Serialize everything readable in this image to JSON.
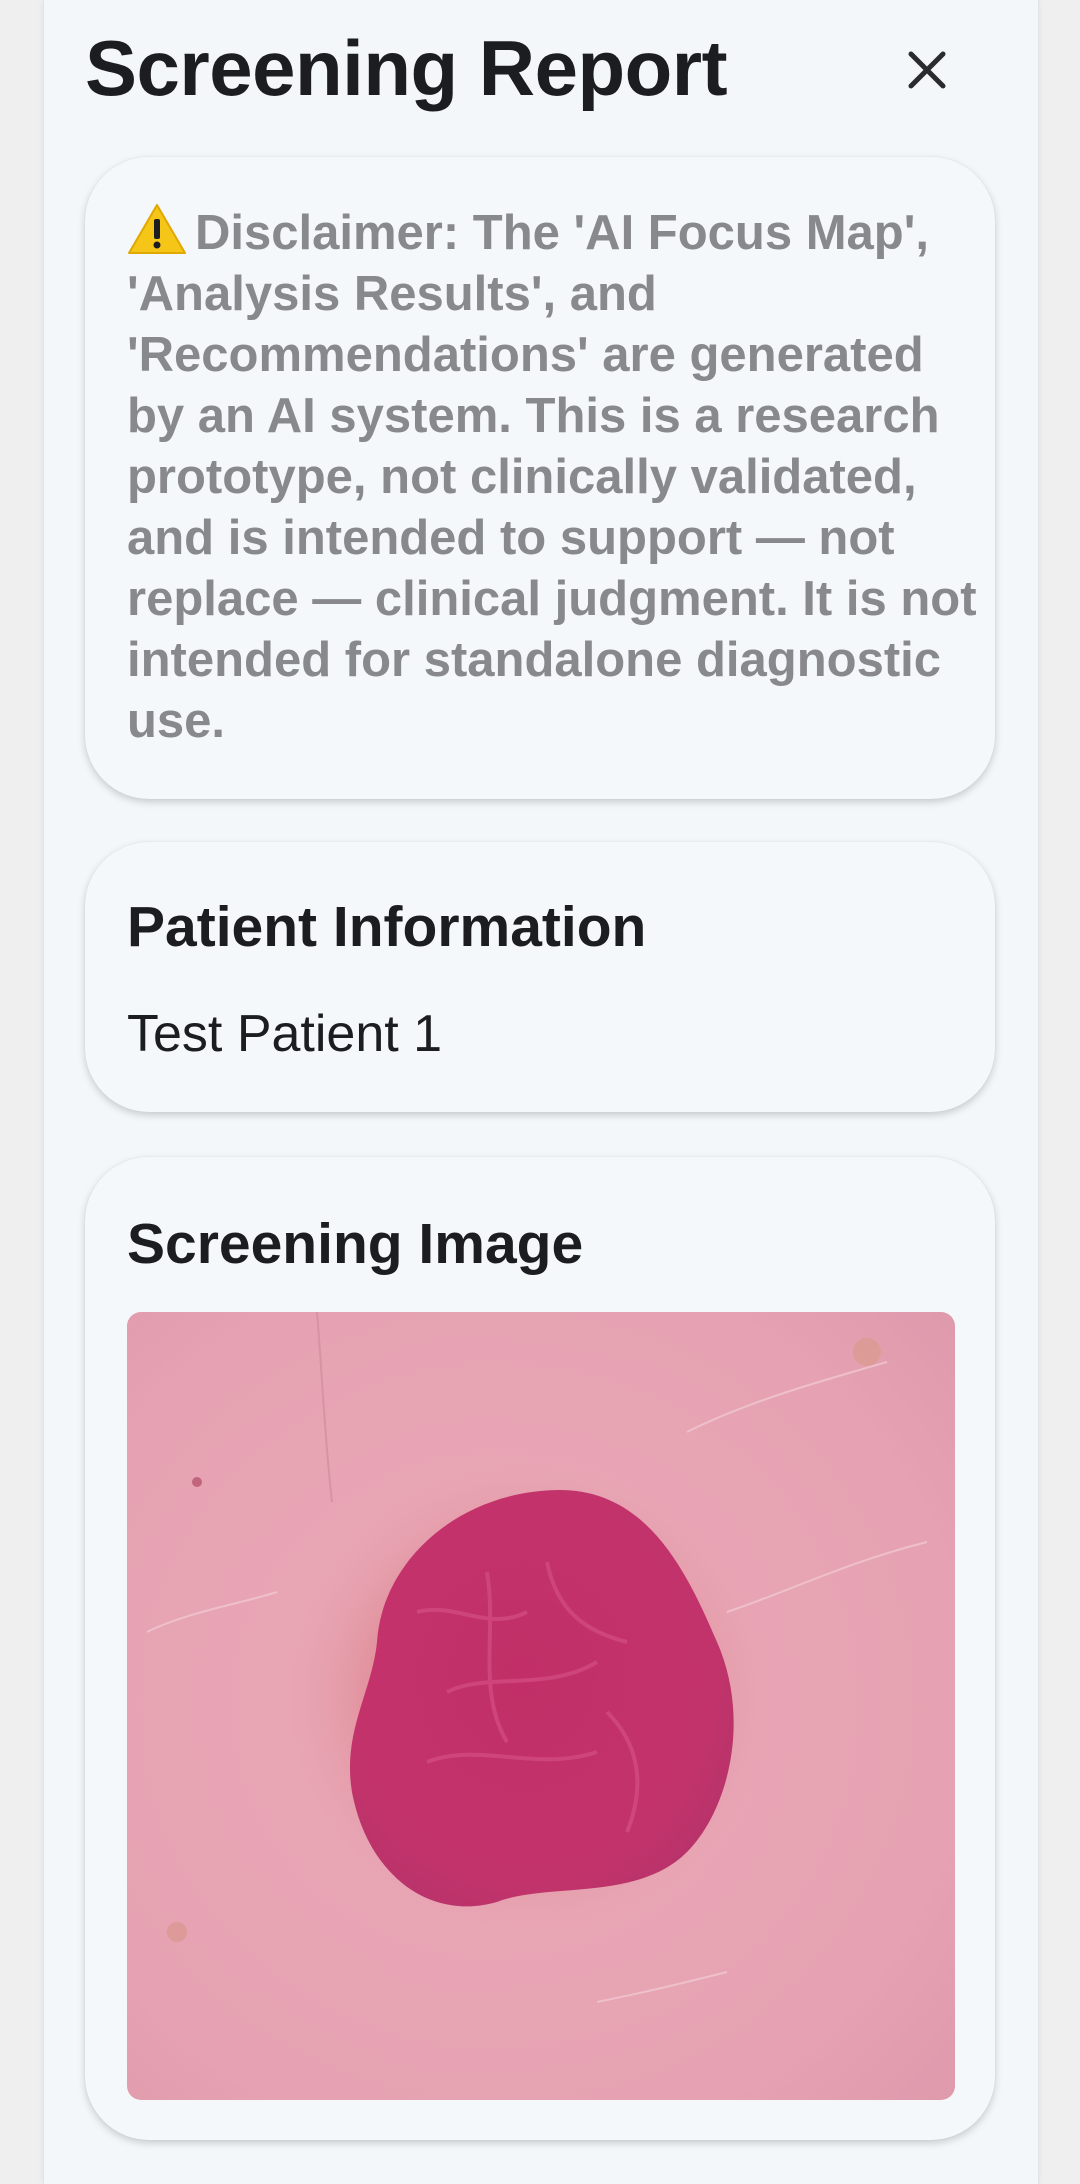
{
  "header": {
    "title": "Screening Report",
    "close_icon": "close-icon"
  },
  "disclaimer": {
    "icon": "warning-icon",
    "text": "Disclaimer: The 'AI Focus Map', 'Analysis Results', and 'Recommendations' are generated by an AI system. This is a research prototype, not clinically validated, and is intended to support — not replace — clinical judgment. It is not intended for standalone diagnostic use."
  },
  "patient": {
    "heading": "Patient Information",
    "name": "Test Patient 1"
  },
  "screening": {
    "heading": "Screening Image"
  },
  "colors": {
    "background": "#f3f7fa",
    "text_primary": "#1c1d21",
    "text_muted": "#87898d",
    "warning": "#f5c518",
    "lesion": "#c8346a",
    "skin": "#e8a6b4"
  }
}
